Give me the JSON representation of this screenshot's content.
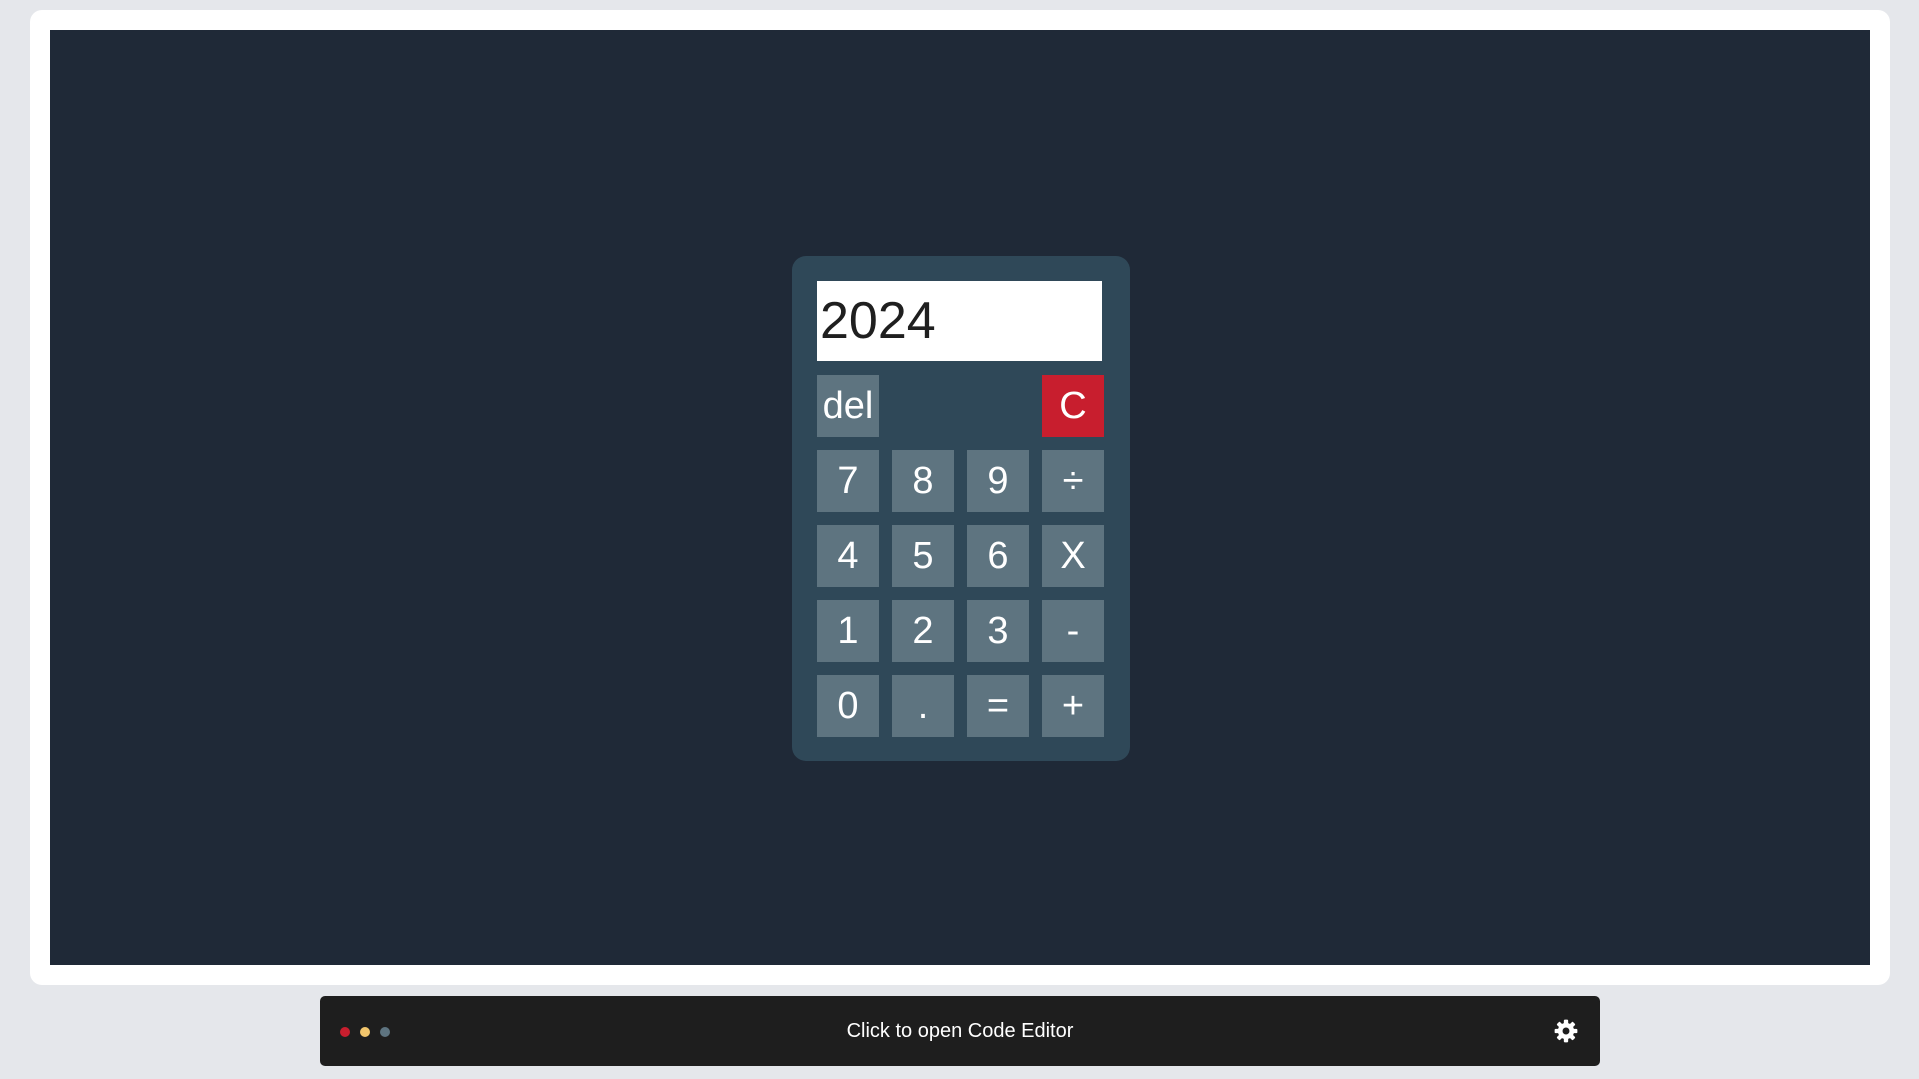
{
  "calculator": {
    "display_value": "2024",
    "keys": {
      "del": "del",
      "clear": "C",
      "seven": "7",
      "eight": "8",
      "nine": "9",
      "divide": "÷",
      "four": "4",
      "five": "5",
      "six": "6",
      "multiply": "X",
      "one": "1",
      "two": "2",
      "three": "3",
      "subtract": "-",
      "zero": "0",
      "decimal": ".",
      "equals": "=",
      "add": "+"
    }
  },
  "editor_bar": {
    "label": "Click to open Code Editor",
    "icon": "gear-icon",
    "dot_colors": [
      "#c81e2e",
      "#f2c66d",
      "#5e7480"
    ]
  },
  "colors": {
    "page_background": "#e5e7eb",
    "stage_background": "#1f2937",
    "calculator_body": "#2f4858",
    "key_background": "#5e7480",
    "clear_key": "#c81e2e",
    "bar_background": "#1e1e1e"
  }
}
